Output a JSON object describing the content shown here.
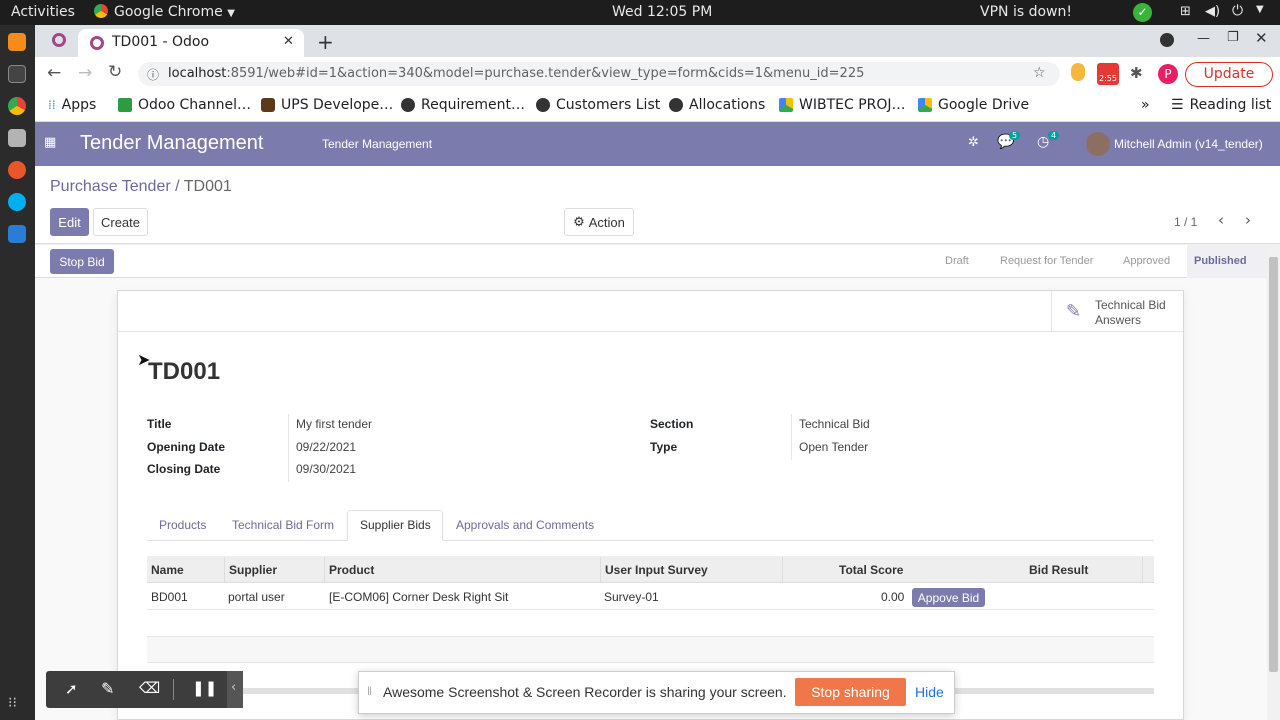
{
  "system": {
    "activities": "Activities",
    "app_name": "Google Chrome",
    "clock": "Wed 12:05 PM",
    "vpn_status": "VPN is down!"
  },
  "browser": {
    "tab_title": "TD001 - Odoo",
    "url_host": "localhost",
    "url_rest": ":8591/web#id=1&action=340&model=purchase.tender&view_type=form&cids=1&menu_id=225",
    "ext_badge": "2:55",
    "profile_initial": "P",
    "update_label": "Update",
    "bookmarks": [
      "Apps",
      "Odoo Channel…",
      "UPS Develope…",
      "Requirement…",
      "Customers List",
      "Allocations",
      "WIBTEC PROJ…",
      "Google Drive"
    ],
    "reading_list": "Reading list"
  },
  "odoo": {
    "app_title": "Tender Management",
    "menu_item": "Tender Management",
    "messages_count": "5",
    "activities_count": "4",
    "user": "Mitchell Admin (v14_tender)",
    "accent": "#7c7bad"
  },
  "control": {
    "breadcrumb_parent": "Purchase Tender",
    "breadcrumb_sep": "/",
    "breadcrumb_current": "TD001",
    "edit_label": "Edit",
    "create_label": "Create",
    "action_label": "Action",
    "pager": "1 / 1"
  },
  "status": {
    "stop_bid_label": "Stop Bid",
    "stages": [
      "Draft",
      "Request for Tender",
      "Approved",
      "Published"
    ],
    "active_stage": "Published"
  },
  "form": {
    "smart_button": "Technical Bid Answers",
    "smart_line1": "Technical Bid",
    "smart_line2": "Answers",
    "record_name": "TD001",
    "fields_left": [
      {
        "label": "Title",
        "value": "My first tender"
      },
      {
        "label": "Opening Date",
        "value": "09/22/2021"
      },
      {
        "label": "Closing Date",
        "value": "09/30/2021"
      }
    ],
    "fields_right": [
      {
        "label": "Section",
        "value": "Technical Bid"
      },
      {
        "label": "Type",
        "value": "Open Tender"
      }
    ],
    "tabs": [
      "Products",
      "Technical Bid Form",
      "Supplier Bids",
      "Approvals and Comments"
    ],
    "active_tab": "Supplier Bids",
    "table": {
      "headers": [
        "Name",
        "Supplier",
        "Product",
        "User Input Survey",
        "Total Score",
        "Bid Result"
      ],
      "rows": [
        {
          "name": "BD001",
          "supplier": "portal user",
          "product": "[E-COM06] Corner Desk Right Sit",
          "survey": "Survey-01",
          "score": "0.00",
          "action": "Appove Bid"
        }
      ]
    }
  },
  "overlay": {
    "share_text": "Awesome Screenshot & Screen Recorder is sharing your screen.",
    "stop_sharing": "Stop sharing",
    "hide": "Hide"
  }
}
